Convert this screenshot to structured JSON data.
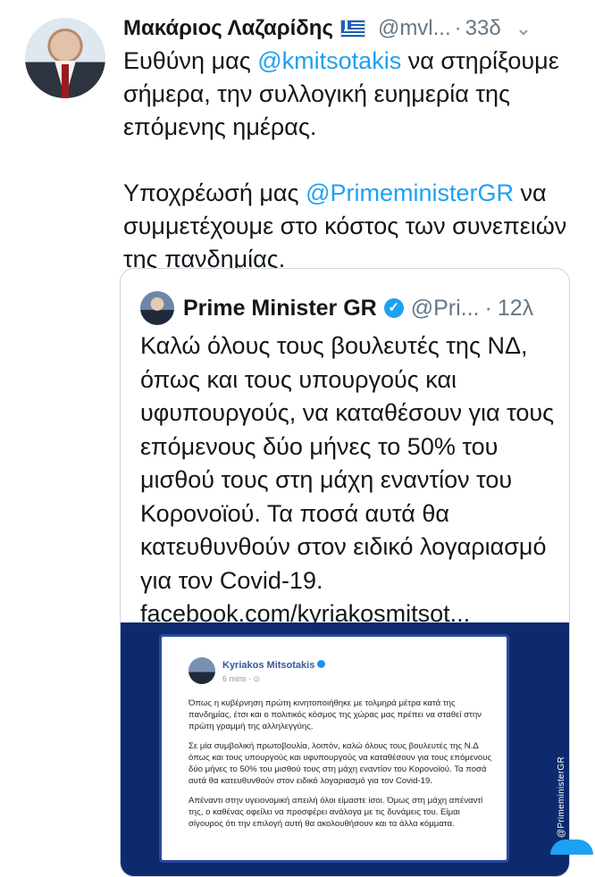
{
  "tweet": {
    "author_name": "Μακάριος Λαζαρίδης",
    "flag_icon": "greek-flag-icon",
    "handle": "@mvl...",
    "separator": "·",
    "time": "33δ",
    "menu_icon": "chevron-down-icon",
    "text_p1_a": "Ευθύνη μας ",
    "text_p1_mention": "@kmitsotakis",
    "text_p1_b": " να στηρίξουμε σήμερα, την συλλογική ευημερία της επόμενης ημέρας.",
    "text_p2_a": "Υποχρέωσή μας ",
    "text_p2_mention": "@PrimeministerGR",
    "text_p2_b": " να συμμετέχουμε στο κόστος των συνεπειών της πανδημίας."
  },
  "quoted": {
    "author_name": "Prime Minister GR",
    "verified_icon": "verified-badge-icon",
    "handle": "@Pri...",
    "separator": "·",
    "time": "12λ",
    "text": "Καλώ όλους τους βουλευτές της ΝΔ, όπως και τους υπουργούς και υφυπουργούς, να καταθέσουν για τους επόμενους δύο μήνες το 50% του μισθού τους στη μάχη εναντίον του Κορονοϊού. Τα ποσά αυτά θα κατευθυνθούν στον ειδικό λογαριασμό για τον Covid-19.",
    "link": "facebook.com/kyriakosmitsot..."
  },
  "media": {
    "fb_name": "Kyriakos Mitsotakis",
    "fb_meta": "6 mins · ⊙",
    "fb_p1": "Όπως η κυβέρνηση πρώτη κινητοποιήθηκε με τολμηρά μέτρα κατά της πανδημίας, έτσι και ο πολιτικός κόσμος της χώρας μας πρέπει να σταθεί στην πρώτη γραμμή της αλληλεγγύης.",
    "fb_p2": "Σε μία συμβολική πρωτοβουλία, λοιπόν, καλώ όλους τους βουλευτές της Ν.Δ όπως και τους υπουργούς και υφυπουργούς να καταθέσουν για τους επόμενους δύο μήνες το 50% του μισθού τους στη μάχη εναντίον του Κορονοϊού. Τα ποσά αυτά θα κατευθυνθούν στον ειδικό λογαριασμό για τον Covid-19.",
    "fb_p3": "Απέναντι στην υγειονομική απειλή όλοι είμαστε ίσοι. Όμως στη μάχη απέναντί της, ο καθένας οφείλει να προσφέρει ανάλογα με τις δυνάμεις του. Είμαι σίγουρος ότι την επιλογή αυτή θα ακολουθήσουν και τα άλλα κόμματα.",
    "side_label": "@PrimeministerGR"
  },
  "colors": {
    "link": "#1da1f2",
    "muted": "#657786",
    "media_bg": "#0d2a6e"
  }
}
